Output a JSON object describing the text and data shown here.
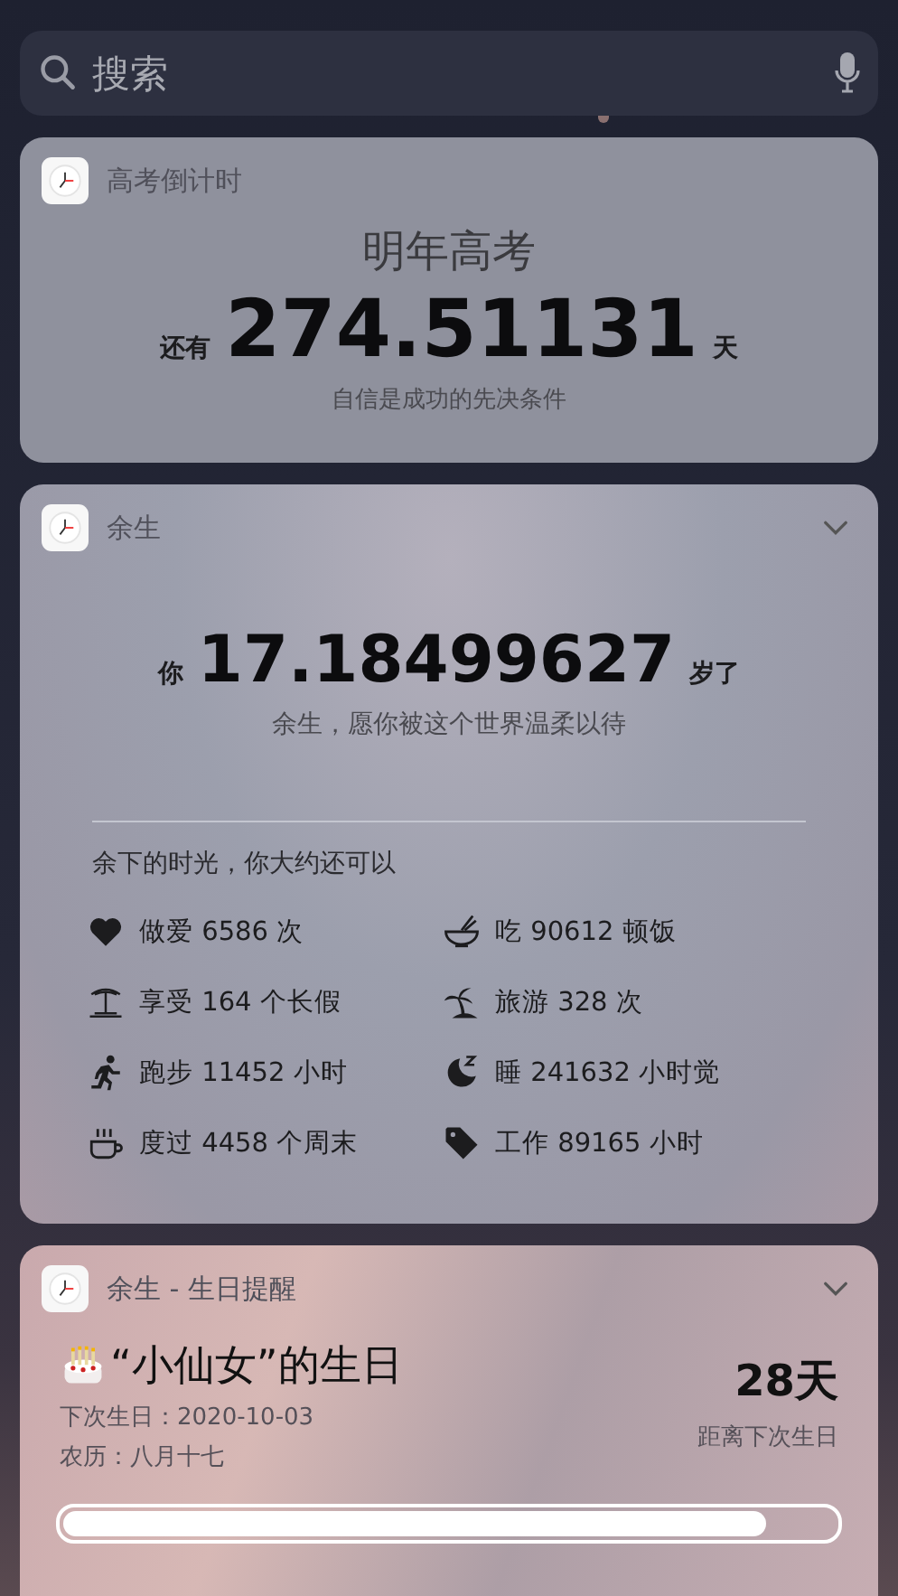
{
  "search": {
    "placeholder": "搜索"
  },
  "widgets": [
    {
      "kind": "countdown",
      "app": "高考倒计时",
      "expandable": false,
      "title": "明年高考",
      "prefix": "还有",
      "value": "274.51131",
      "suffix": "天",
      "motto": "自信是成功的先决条件"
    },
    {
      "kind": "life",
      "app": "余生",
      "expandable": true,
      "prefix": "你",
      "value": "17.18499627",
      "suffix": "岁了",
      "motto": "余生，愿你被这个世界温柔以待",
      "intro": "余下的时光，你大约还可以",
      "stats": [
        {
          "kind": "heart",
          "text": "做爱 6586 次"
        },
        {
          "kind": "bowl",
          "text": "吃 90612 顿饭"
        },
        {
          "kind": "beach",
          "text": "享受 164 个长假"
        },
        {
          "kind": "palm",
          "text": "旅游 328 次"
        },
        {
          "kind": "run",
          "text": "跑步 11452 小时"
        },
        {
          "kind": "moon",
          "text": "睡 241632 小时觉"
        },
        {
          "kind": "cup",
          "text": "度过 4458 个周末"
        },
        {
          "kind": "tag",
          "text": "工作 89165 小时"
        }
      ]
    },
    {
      "kind": "birthday",
      "app": "余生 - 生日提醒",
      "expandable": true,
      "title": "“小仙女”的生日",
      "next": "下次生日：2020-10-03",
      "lunar": "农历：八月十七",
      "days": "28天",
      "days_label": "距离下次生日",
      "level": 0.91
    }
  ]
}
